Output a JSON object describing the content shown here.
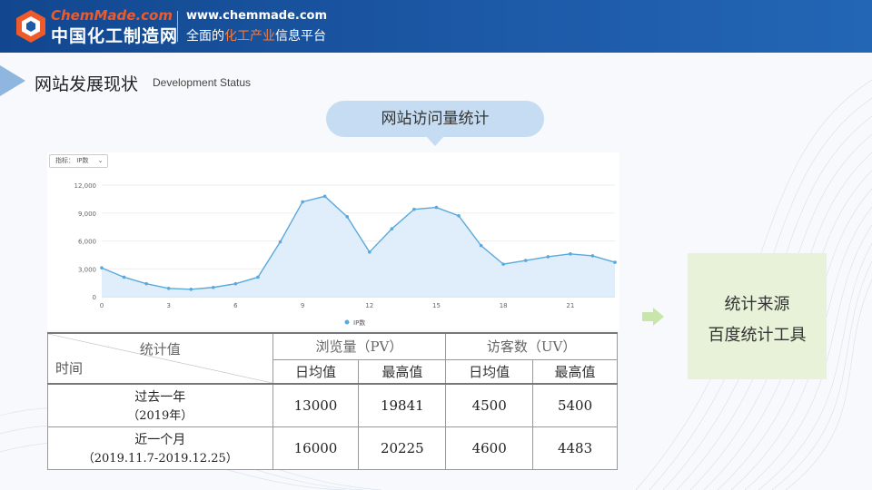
{
  "header": {
    "logo_en": "ChemMade.com",
    "logo_cn": "中国化工制造网",
    "url": "www.chemmade.com",
    "slogan_pre": "全面的",
    "slogan_highlight": "化工产业",
    "slogan_post": "信息平台"
  },
  "section": {
    "title": "网站发展现状",
    "subtitle": "Development Status"
  },
  "bubble": {
    "text": "网站访问量统计"
  },
  "metric_select": {
    "label": "指标： IP数"
  },
  "chart_data": {
    "type": "area",
    "x": [
      0,
      1,
      2,
      3,
      4,
      5,
      6,
      7,
      8,
      9,
      10,
      11,
      12,
      13,
      14,
      15,
      16,
      17,
      18,
      19,
      20,
      21,
      22,
      23
    ],
    "series": [
      {
        "name": "IP数",
        "values": [
          3100,
          2100,
          1400,
          900,
          800,
          1000,
          1400,
          2100,
          5900,
          10200,
          10800,
          8600,
          4800,
          7300,
          9400,
          9600,
          8700,
          5500,
          3500,
          3900,
          4300,
          4600,
          4400,
          3700
        ]
      }
    ],
    "x_ticks": [
      "0",
      "3",
      "6",
      "9",
      "12",
      "15",
      "18",
      "21"
    ],
    "y_ticks": [
      "0",
      "3,000",
      "6,000",
      "9,000",
      "12,000"
    ],
    "ylim": [
      0,
      12000
    ],
    "xlim": [
      0,
      23
    ],
    "grid": true,
    "legend_position": "bottom-center",
    "color": "#5aa9dc"
  },
  "table": {
    "corner_top": "统计值",
    "corner_bottom": "时间",
    "pv_header": "浏览量（PV）",
    "uv_header": "访客数（UV）",
    "sub_headers": [
      "日均值",
      "最高值",
      "日均值",
      "最高值"
    ],
    "rows": [
      {
        "period_line1": "过去一年",
        "period_line2": "（2019年）",
        "values": [
          "13000",
          "19841",
          "4500",
          "5400"
        ]
      },
      {
        "period_line1": "近一个月",
        "period_line2": "（2019.11.7-2019.12.25）",
        "values": [
          "16000",
          "20225",
          "4600",
          "4483"
        ]
      }
    ]
  },
  "source_box": {
    "line1": "统计来源",
    "line2": "百度统计工具"
  },
  "colors": {
    "header_bg": "#1d5aa8",
    "accent_orange": "#ef5a2a",
    "bubble_bg": "#c6dcf2",
    "source_bg": "#e7f2d9",
    "arrow_green": "#c8e6a9"
  }
}
